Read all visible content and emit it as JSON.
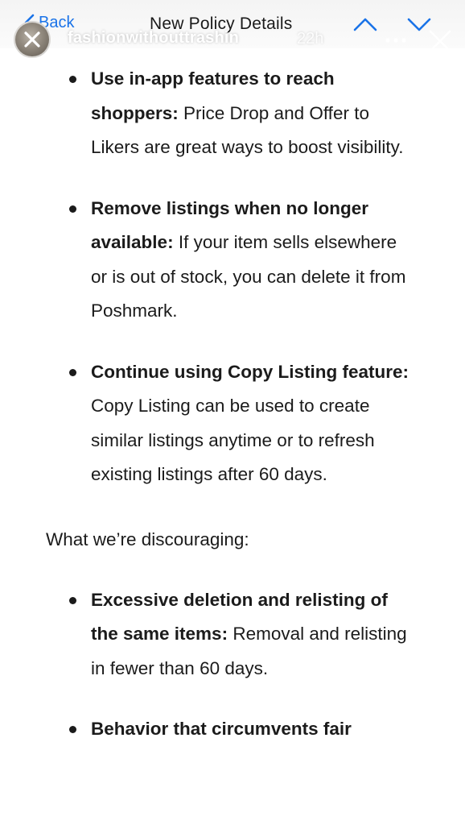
{
  "nav": {
    "back_label": "Back",
    "title": "New Policy Details"
  },
  "story": {
    "username": "fashionwithouttrashin",
    "time": "22h"
  },
  "content": {
    "bullets": [
      {
        "bold": "Use in-app features to reach shoppers:",
        "text": " Price Drop and Offer to Likers are great ways to boost visibility."
      },
      {
        "bold": "Remove listings when no longer available:",
        "text": " If your item sells elsewhere or is out of stock, you can delete it from Poshmark."
      },
      {
        "bold": "Continue using Copy Listing feature:",
        "text": " Copy Listing can be used to create similar listings anytime or to refresh existing listings after 60 days."
      }
    ],
    "discouraging_heading": "What we’re discouraging:",
    "discouraging_bullets": [
      {
        "bold": "Excessive deletion and relisting of the same items:",
        "text": " Removal and relisting in fewer than 60 days."
      },
      {
        "bold": "Behavior that circumvents fair",
        "text": ""
      }
    ]
  },
  "colors": {
    "link_blue": "#1a73e8",
    "text": "#1b1b1b"
  },
  "icons": {
    "back": "chevron-left-icon",
    "up": "chevron-up-icon",
    "down": "chevron-down-icon",
    "overlay_close": "close-icon",
    "more": "more-horizontal-icon",
    "story_close": "close-icon"
  }
}
